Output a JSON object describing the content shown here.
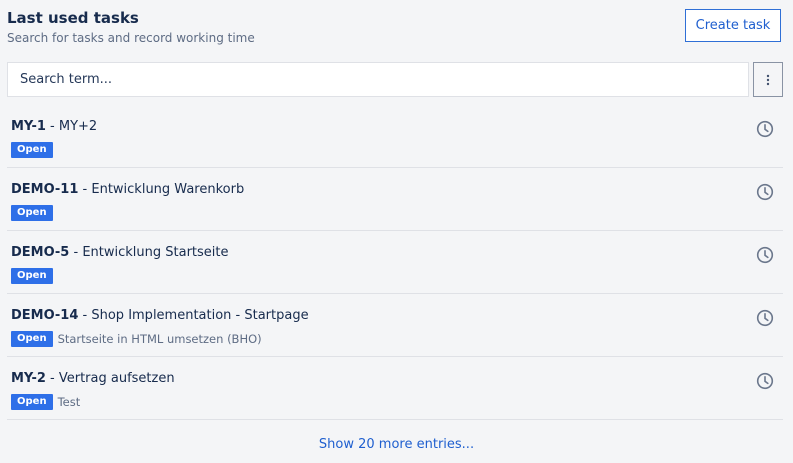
{
  "header": {
    "title": "Last used tasks",
    "subtitle": "Search for tasks and record working time",
    "create_label": "Create task"
  },
  "search": {
    "placeholder": "Search term...",
    "value": "",
    "more_icon": "vertical-ellipsis-icon"
  },
  "tasks": [
    {
      "key": "MY-1",
      "separator": " - ",
      "name": "MY+2",
      "status": "Open",
      "description": "",
      "action_icon": "clock-icon"
    },
    {
      "key": "DEMO-11",
      "separator": " - ",
      "name": "Entwicklung Warenkorb",
      "status": "Open",
      "description": "",
      "action_icon": "clock-icon"
    },
    {
      "key": "DEMO-5",
      "separator": " - ",
      "name": "Entwicklung Startseite",
      "status": "Open",
      "description": "",
      "action_icon": "clock-icon"
    },
    {
      "key": "DEMO-14",
      "separator": " - ",
      "name": "Shop Implementation - Startpage",
      "status": "Open",
      "description": "Startseite in HTML umsetzen (BHO)",
      "action_icon": "clock-icon"
    },
    {
      "key": "MY-2",
      "separator": " - ",
      "name": "Vertrag aufsetzen",
      "status": "Open",
      "description": "Test",
      "action_icon": "clock-icon"
    }
  ],
  "footer": {
    "show_more_label": "Show 20 more entries..."
  },
  "colors": {
    "accent": "#1f5fcf",
    "badge": "#2e6fe8",
    "background": "#f4f5f7"
  }
}
